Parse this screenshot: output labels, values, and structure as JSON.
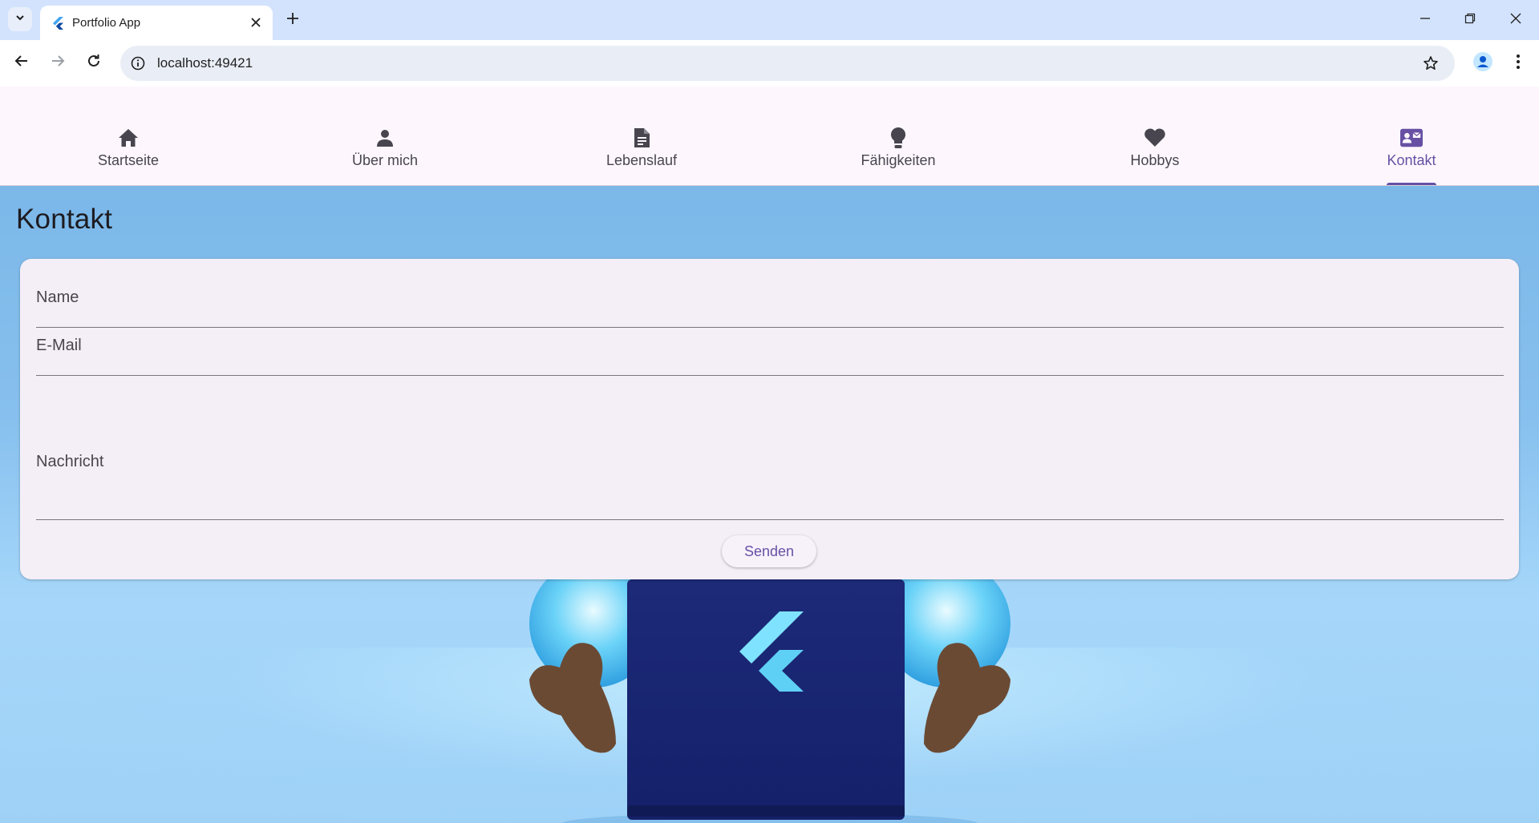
{
  "browser": {
    "tab_title": "Portfolio App",
    "url": "localhost:49421"
  },
  "nav": {
    "tabs": [
      {
        "label": "Startseite",
        "icon": "home-icon"
      },
      {
        "label": "Über mich",
        "icon": "person-icon"
      },
      {
        "label": "Lebenslauf",
        "icon": "document-icon"
      },
      {
        "label": "Fähigkeiten",
        "icon": "lightbulb-icon"
      },
      {
        "label": "Hobbys",
        "icon": "heart-icon"
      },
      {
        "label": "Kontakt",
        "icon": "contact-mail-icon",
        "active": true
      }
    ]
  },
  "page": {
    "title": "Kontakt"
  },
  "form": {
    "name_label": "Name",
    "email_label": "E-Mail",
    "message_label": "Nachricht",
    "name_value": "",
    "email_value": "",
    "message_value": "",
    "submit_label": "Senden"
  },
  "colors": {
    "accent": "#6750a4",
    "app_bar": "#fdf7fd",
    "card": "#f4eff6",
    "background": "#87c0ee",
    "browser_frame": "#d3e3fd"
  }
}
